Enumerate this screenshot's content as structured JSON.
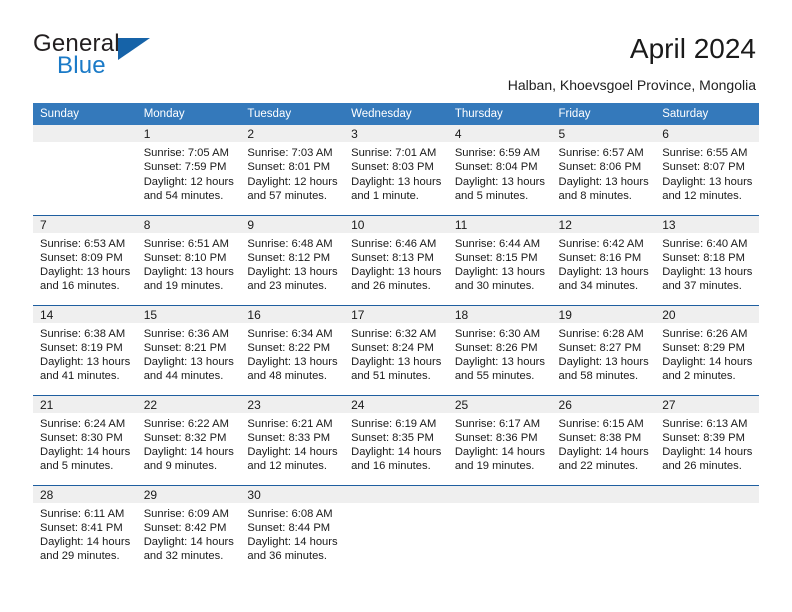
{
  "brand": {
    "name_part1": "General",
    "name_part2": "Blue",
    "logo_icon": "triangle-flag-icon",
    "accent_color": "#1a7ac7"
  },
  "header": {
    "title": "April 2024",
    "subtitle": "Halban, Khoevsgoel Province, Mongolia"
  },
  "calendar": {
    "header_bg_color": "#3479bb",
    "daynum_bg_color": "#efefef",
    "grid_line_color": "#1f5fa0",
    "weekday_headers": [
      "Sunday",
      "Monday",
      "Tuesday",
      "Wednesday",
      "Thursday",
      "Friday",
      "Saturday"
    ],
    "weeks": [
      [
        {
          "day": "",
          "sunrise": "",
          "sunset": "",
          "daylight": "",
          "empty": true
        },
        {
          "day": "1",
          "sunrise": "Sunrise: 7:05 AM",
          "sunset": "Sunset: 7:59 PM",
          "daylight": "Daylight: 12 hours and 54 minutes."
        },
        {
          "day": "2",
          "sunrise": "Sunrise: 7:03 AM",
          "sunset": "Sunset: 8:01 PM",
          "daylight": "Daylight: 12 hours and 57 minutes."
        },
        {
          "day": "3",
          "sunrise": "Sunrise: 7:01 AM",
          "sunset": "Sunset: 8:03 PM",
          "daylight": "Daylight: 13 hours and 1 minute."
        },
        {
          "day": "4",
          "sunrise": "Sunrise: 6:59 AM",
          "sunset": "Sunset: 8:04 PM",
          "daylight": "Daylight: 13 hours and 5 minutes."
        },
        {
          "day": "5",
          "sunrise": "Sunrise: 6:57 AM",
          "sunset": "Sunset: 8:06 PM",
          "daylight": "Daylight: 13 hours and 8 minutes."
        },
        {
          "day": "6",
          "sunrise": "Sunrise: 6:55 AM",
          "sunset": "Sunset: 8:07 PM",
          "daylight": "Daylight: 13 hours and 12 minutes."
        }
      ],
      [
        {
          "day": "7",
          "sunrise": "Sunrise: 6:53 AM",
          "sunset": "Sunset: 8:09 PM",
          "daylight": "Daylight: 13 hours and 16 minutes."
        },
        {
          "day": "8",
          "sunrise": "Sunrise: 6:51 AM",
          "sunset": "Sunset: 8:10 PM",
          "daylight": "Daylight: 13 hours and 19 minutes."
        },
        {
          "day": "9",
          "sunrise": "Sunrise: 6:48 AM",
          "sunset": "Sunset: 8:12 PM",
          "daylight": "Daylight: 13 hours and 23 minutes."
        },
        {
          "day": "10",
          "sunrise": "Sunrise: 6:46 AM",
          "sunset": "Sunset: 8:13 PM",
          "daylight": "Daylight: 13 hours and 26 minutes."
        },
        {
          "day": "11",
          "sunrise": "Sunrise: 6:44 AM",
          "sunset": "Sunset: 8:15 PM",
          "daylight": "Daylight: 13 hours and 30 minutes."
        },
        {
          "day": "12",
          "sunrise": "Sunrise: 6:42 AM",
          "sunset": "Sunset: 8:16 PM",
          "daylight": "Daylight: 13 hours and 34 minutes."
        },
        {
          "day": "13",
          "sunrise": "Sunrise: 6:40 AM",
          "sunset": "Sunset: 8:18 PM",
          "daylight": "Daylight: 13 hours and 37 minutes."
        }
      ],
      [
        {
          "day": "14",
          "sunrise": "Sunrise: 6:38 AM",
          "sunset": "Sunset: 8:19 PM",
          "daylight": "Daylight: 13 hours and 41 minutes."
        },
        {
          "day": "15",
          "sunrise": "Sunrise: 6:36 AM",
          "sunset": "Sunset: 8:21 PM",
          "daylight": "Daylight: 13 hours and 44 minutes."
        },
        {
          "day": "16",
          "sunrise": "Sunrise: 6:34 AM",
          "sunset": "Sunset: 8:22 PM",
          "daylight": "Daylight: 13 hours and 48 minutes."
        },
        {
          "day": "17",
          "sunrise": "Sunrise: 6:32 AM",
          "sunset": "Sunset: 8:24 PM",
          "daylight": "Daylight: 13 hours and 51 minutes."
        },
        {
          "day": "18",
          "sunrise": "Sunrise: 6:30 AM",
          "sunset": "Sunset: 8:26 PM",
          "daylight": "Daylight: 13 hours and 55 minutes."
        },
        {
          "day": "19",
          "sunrise": "Sunrise: 6:28 AM",
          "sunset": "Sunset: 8:27 PM",
          "daylight": "Daylight: 13 hours and 58 minutes."
        },
        {
          "day": "20",
          "sunrise": "Sunrise: 6:26 AM",
          "sunset": "Sunset: 8:29 PM",
          "daylight": "Daylight: 14 hours and 2 minutes."
        }
      ],
      [
        {
          "day": "21",
          "sunrise": "Sunrise: 6:24 AM",
          "sunset": "Sunset: 8:30 PM",
          "daylight": "Daylight: 14 hours and 5 minutes."
        },
        {
          "day": "22",
          "sunrise": "Sunrise: 6:22 AM",
          "sunset": "Sunset: 8:32 PM",
          "daylight": "Daylight: 14 hours and 9 minutes."
        },
        {
          "day": "23",
          "sunrise": "Sunrise: 6:21 AM",
          "sunset": "Sunset: 8:33 PM",
          "daylight": "Daylight: 14 hours and 12 minutes."
        },
        {
          "day": "24",
          "sunrise": "Sunrise: 6:19 AM",
          "sunset": "Sunset: 8:35 PM",
          "daylight": "Daylight: 14 hours and 16 minutes."
        },
        {
          "day": "25",
          "sunrise": "Sunrise: 6:17 AM",
          "sunset": "Sunset: 8:36 PM",
          "daylight": "Daylight: 14 hours and 19 minutes."
        },
        {
          "day": "26",
          "sunrise": "Sunrise: 6:15 AM",
          "sunset": "Sunset: 8:38 PM",
          "daylight": "Daylight: 14 hours and 22 minutes."
        },
        {
          "day": "27",
          "sunrise": "Sunrise: 6:13 AM",
          "sunset": "Sunset: 8:39 PM",
          "daylight": "Daylight: 14 hours and 26 minutes."
        }
      ],
      [
        {
          "day": "28",
          "sunrise": "Sunrise: 6:11 AM",
          "sunset": "Sunset: 8:41 PM",
          "daylight": "Daylight: 14 hours and 29 minutes."
        },
        {
          "day": "29",
          "sunrise": "Sunrise: 6:09 AM",
          "sunset": "Sunset: 8:42 PM",
          "daylight": "Daylight: 14 hours and 32 minutes."
        },
        {
          "day": "30",
          "sunrise": "Sunrise: 6:08 AM",
          "sunset": "Sunset: 8:44 PM",
          "daylight": "Daylight: 14 hours and 36 minutes."
        },
        {
          "day": "",
          "sunrise": "",
          "sunset": "",
          "daylight": "",
          "empty": true
        },
        {
          "day": "",
          "sunrise": "",
          "sunset": "",
          "daylight": "",
          "empty": true
        },
        {
          "day": "",
          "sunrise": "",
          "sunset": "",
          "daylight": "",
          "empty": true
        },
        {
          "day": "",
          "sunrise": "",
          "sunset": "",
          "daylight": "",
          "empty": true
        }
      ]
    ]
  }
}
